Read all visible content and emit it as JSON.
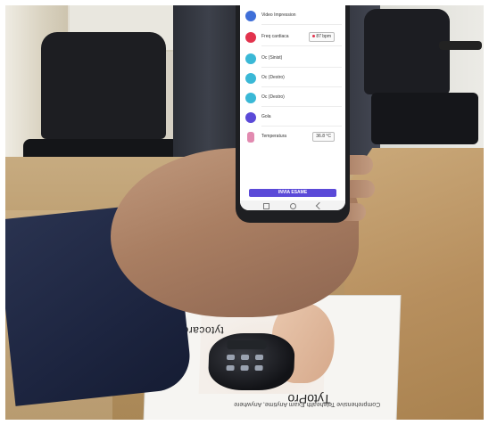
{
  "app": {
    "rows": [
      {
        "label": "Video Impression",
        "icon": "person-icon",
        "color": "#3f6fd8",
        "value": ""
      },
      {
        "label": "Freq cardiaca",
        "icon": "heart-icon",
        "color": "#e2334d",
        "value": "87 bpm"
      },
      {
        "label": "Oc (Sinist)",
        "icon": "ear-icon",
        "color": "#3ab8d6",
        "value": ""
      },
      {
        "label": "Oc (Destro)",
        "icon": "ear-icon",
        "color": "#3ab8d6",
        "value": ""
      },
      {
        "label": "Oc (Destro)",
        "icon": "ear-icon",
        "color": "#3ab8d6",
        "value": ""
      },
      {
        "label": "Gola",
        "icon": "throat-icon",
        "color": "#5b4ad8",
        "value": ""
      },
      {
        "label": "Temperatura",
        "icon": "thermometer-icon",
        "color": "#e28ab0",
        "value": "36.8 °C"
      }
    ],
    "send_button": "INVIA ESAME"
  },
  "product_box": {
    "brand": "tytocare",
    "name": "TytoPro",
    "tagline": "Comprehensive Telehealth Exam Anytime, Anywhere"
  }
}
